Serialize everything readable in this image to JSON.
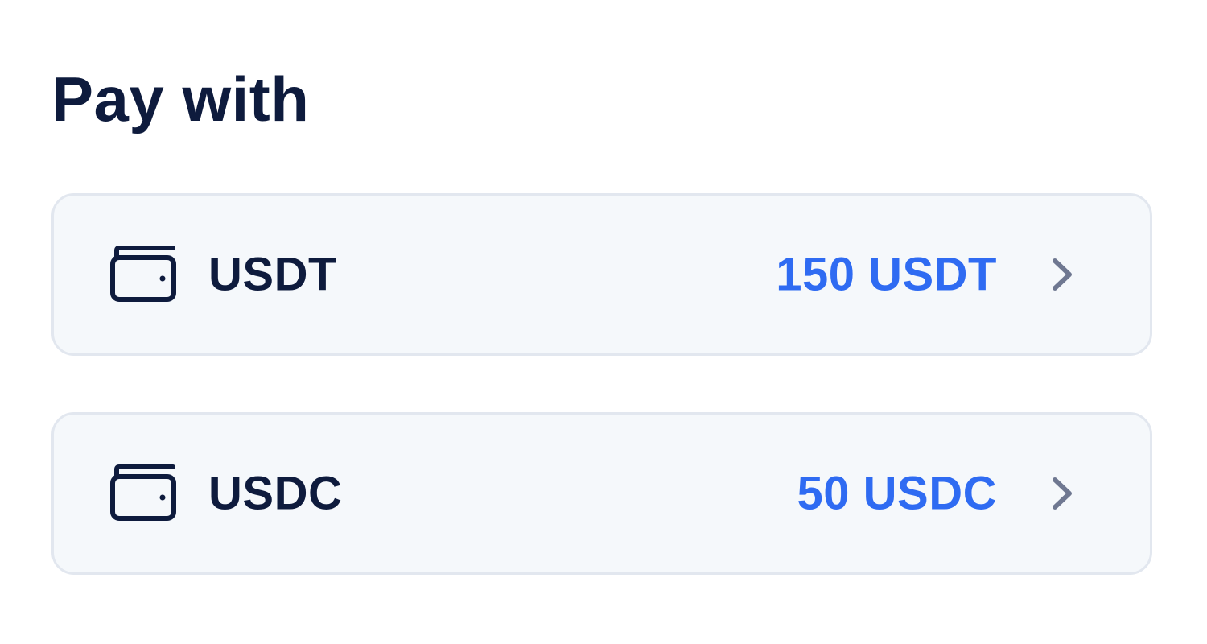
{
  "header": {
    "title": "Pay with"
  },
  "options": [
    {
      "name": "USDT",
      "balance": "150 USDT",
      "icon": "wallet-icon",
      "trailing_icon": "chevron-right-icon"
    },
    {
      "name": "USDC",
      "balance": "50 USDC",
      "icon": "wallet-icon",
      "trailing_icon": "chevron-right-icon"
    }
  ],
  "colors": {
    "title_text": "#0e1b3d",
    "balance_text": "#2f6bf2",
    "card_background": "#f5f8fb",
    "card_border": "#e2e7ef",
    "chevron": "#6f7891"
  }
}
